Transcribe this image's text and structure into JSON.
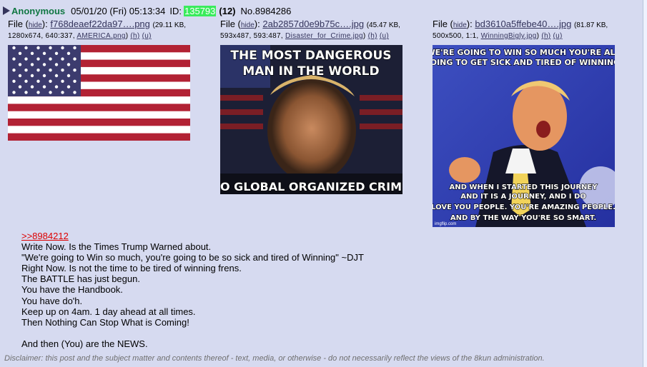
{
  "post": {
    "name": "Anonymous",
    "date": "05/01/20 (Fri) 05:13:34",
    "id_label": "ID:",
    "id": "135793",
    "id_color": "#3aeb5c",
    "reply_count": "(12)",
    "post_number": "No.8984286"
  },
  "files": [
    {
      "file_label": "File (",
      "hide": "hide",
      "close": "):",
      "filename": "f768deaef22da97….png",
      "meta_prefix": "(29.11 KB,",
      "meta_line2": "1280x674, 640:337,",
      "orig_name": "AMERICA.png",
      "h": "(h)",
      "u": "(u)"
    },
    {
      "file_label": "File (",
      "hide": "hide",
      "close": "):",
      "filename": "2ab2857d0e9b75c….jpg",
      "meta_prefix": "(45.47 KB,",
      "meta_line2": "593x487, 593:487,",
      "orig_name": "Disaster_for_Crime.jpg",
      "h": "(h)",
      "u": "(u)",
      "caption_top_1": "THE MOST DANGEROUS",
      "caption_top_2": "MAN IN THE WORLD",
      "caption_bottom": "TO GLOBAL ORGANIZED CRIME"
    },
    {
      "file_label": "File (",
      "hide": "hide",
      "close": "):",
      "filename": "bd3610a5ffebe40….jpg",
      "meta_prefix": "(81.87 KB,",
      "meta_line2": "500x500, 1:1,",
      "orig_name": "WinningBigly.jpg",
      "h": "(h)",
      "u": "(u)",
      "caption_top_1": "WE'RE GOING TO WIN SO MUCH YOU'RE ALL",
      "caption_top_2": "GOING TO GET SICK AND TIRED OF WINNING.",
      "caption_bottom_1": "AND WHEN I STARTED THIS JOURNEY",
      "caption_bottom_2": "AND IT IS A JOURNEY, AND I DO",
      "caption_bottom_3": "LOVE YOU PEOPLE. YOU'RE AMAZING PEOPLE.",
      "caption_bottom_4": "AND BY THE WAY YOU'RE SO SMART.",
      "watermark": "imgflip.com"
    }
  ],
  "body": {
    "quote": ">>8984212",
    "lines": [
      "Write Now. Is the Times Trump Warned about.",
      "\"We're going to Win so much, you're going to be so sick and tired of Winning\" ~DJT",
      "Right Now. Is not the time to be tired of winning frens.",
      "The BATTLE has just begun.",
      "You have the Handbook.",
      "You have do'h.",
      "Keep up on 4am. 1 day ahead at all times.",
      "Then Nothing Can Stop What is Coming!",
      "",
      "And then (You) are the NEWS."
    ]
  },
  "disclaimer": "Disclaimer: this post and the subject matter and contents thereof - text, media, or otherwise - do not necessarily reflect the views of the 8kun administration.",
  "colors": {
    "name": "#117743",
    "link": "#34345c",
    "quote": "#dd0000",
    "post_bg": "#d6daf0"
  }
}
